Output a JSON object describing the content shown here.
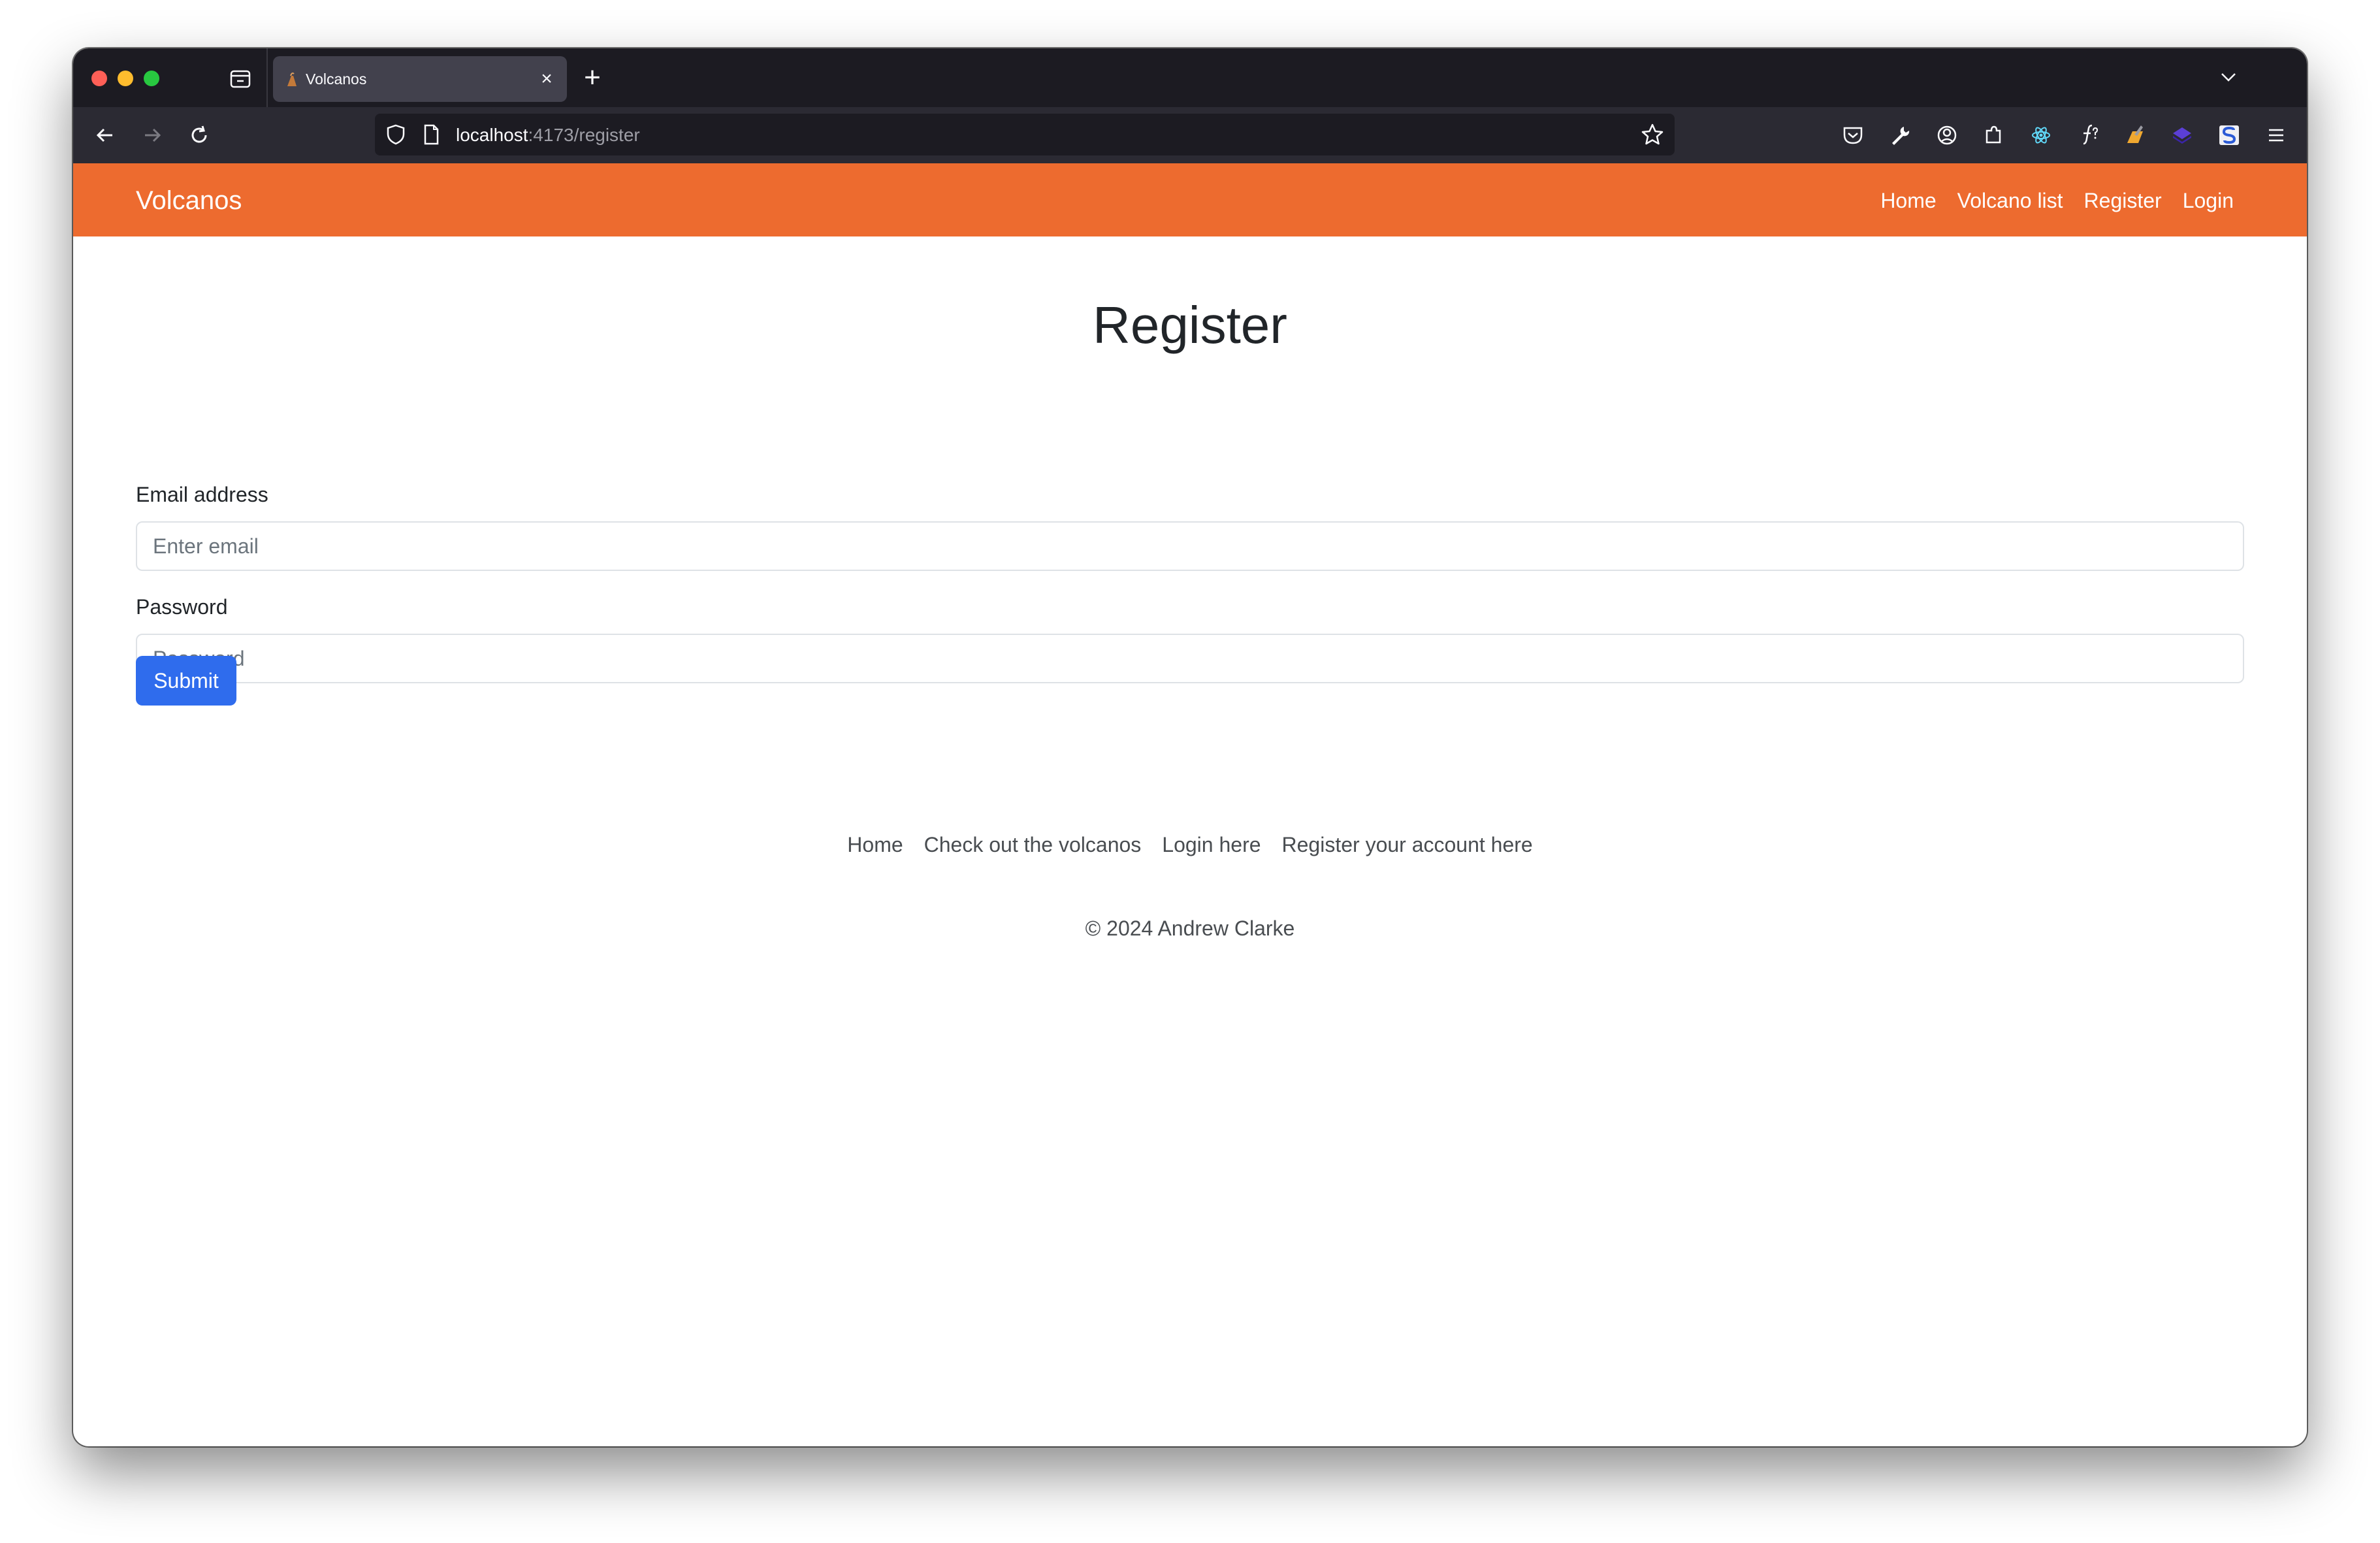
{
  "browser": {
    "tab": {
      "title": "Volcanos",
      "close_icon": "close-icon",
      "favicon": "volcano-favicon-icon"
    },
    "new_tab_symbol": "+",
    "url": {
      "host": "localhost",
      "path": ":4173/register"
    }
  },
  "site": {
    "brand": "Volcanos",
    "nav": [
      {
        "label": "Home"
      },
      {
        "label": "Volcano list"
      },
      {
        "label": "Register"
      },
      {
        "label": "Login"
      }
    ],
    "header_color": "#ed6b2f"
  },
  "form": {
    "title": "Register",
    "email": {
      "label": "Email address",
      "placeholder": "Enter email",
      "value": ""
    },
    "password": {
      "label": "Password",
      "placeholder": "Password",
      "value": ""
    },
    "submit_label": "Submit",
    "submit_color": "#2f6ced"
  },
  "footer": {
    "links": [
      {
        "label": "Home"
      },
      {
        "label": "Check out the volcanos"
      },
      {
        "label": "Login here"
      },
      {
        "label": "Register your account here"
      }
    ],
    "copyright": "© 2024 Andrew Clarke"
  }
}
